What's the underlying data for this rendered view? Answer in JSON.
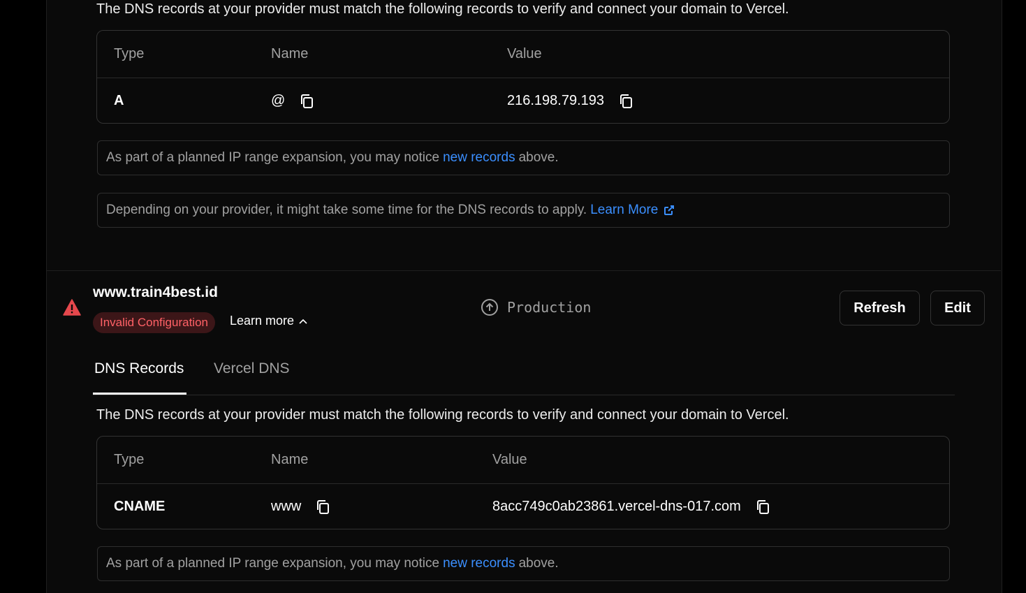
{
  "section1": {
    "intro": "The DNS records at your provider must match the following records to verify and connect your domain to Vercel.",
    "headers": {
      "type": "Type",
      "name": "Name",
      "value": "Value"
    },
    "record": {
      "type": "A",
      "name": "@",
      "value": "216.198.79.193"
    },
    "note1": {
      "before": "As part of a planned IP range expansion, you may notice",
      "link": "new records",
      "after": "above."
    },
    "note2": {
      "before": "Depending on your provider, it might take some time for the DNS records to apply.",
      "link": "Learn More"
    }
  },
  "domain": {
    "name": "www.train4best.id",
    "badge": "Invalid Configuration",
    "learn_more": "Learn more",
    "environment": "Production",
    "refresh_label": "Refresh",
    "edit_label": "Edit"
  },
  "tabs": {
    "dns_records": "DNS Records",
    "vercel_dns": "Vercel DNS"
  },
  "section2": {
    "intro": "The DNS records at your provider must match the following records to verify and connect your domain to Vercel.",
    "headers": {
      "type": "Type",
      "name": "Name",
      "value": "Value"
    },
    "record": {
      "type": "CNAME",
      "name": "www",
      "value": "8acc749c0ab23861.vercel-dns-017.com"
    },
    "note1": {
      "before": "As part of a planned IP range expansion, you may notice",
      "link": "new records",
      "after": "above."
    }
  },
  "colors": {
    "link": "#3b8fff",
    "error": "#ff6166",
    "error_bg": "#3c1618",
    "warning_icon": "#e5484d"
  },
  "icons": [
    "copy-icon",
    "external-link-icon",
    "warning-icon",
    "chevron-up-icon",
    "arrow-up-circle-icon"
  ]
}
